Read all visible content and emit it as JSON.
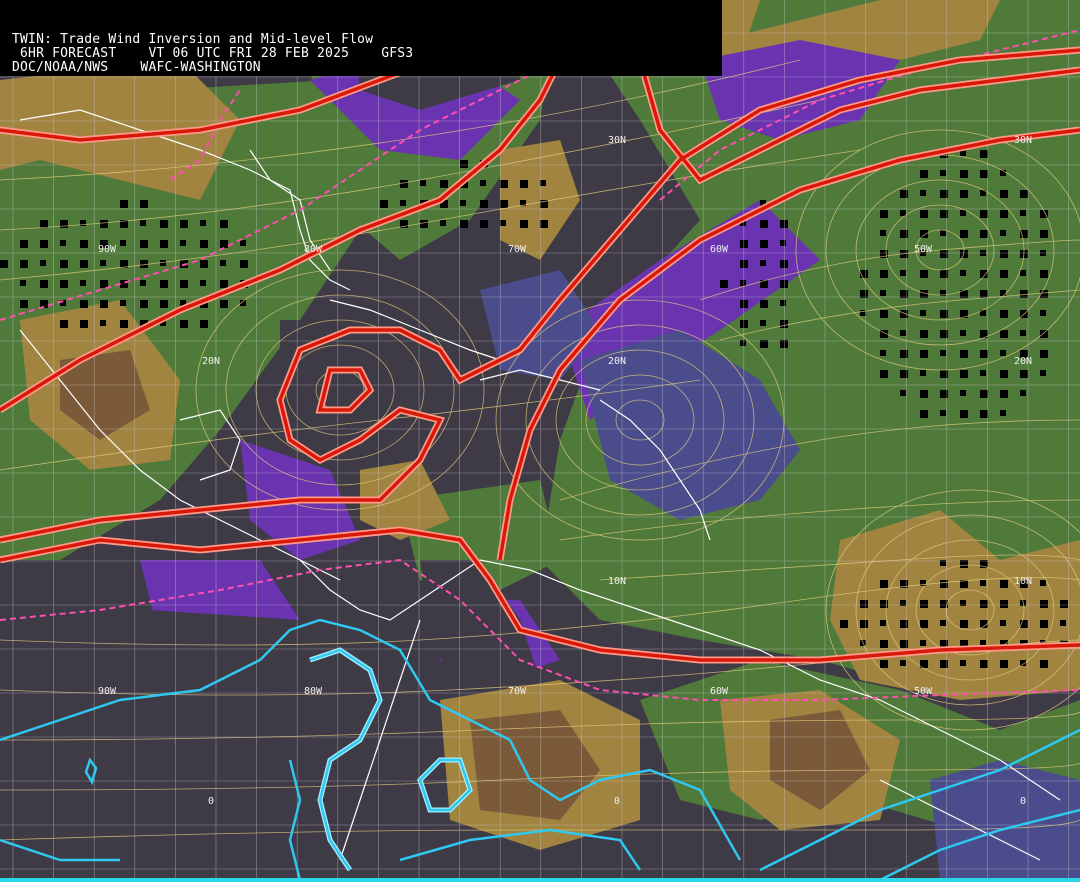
{
  "header": {
    "line1": "TWIN: Trade Wind Inversion and Mid-level Flow",
    "line2": " 6HR FORECAST    VT 06 UTC FRI 28 FEB 2025    GFS3",
    "line3": "DOC/NOAA/NWS    WAFC-WASHINGTON"
  },
  "grid_labels": {
    "lat": [
      "30N",
      "20N",
      "10N",
      "0"
    ],
    "lon": [
      "90W",
      "80W",
      "70W",
      "60W",
      "50W"
    ]
  },
  "colors": {
    "background_low": "#3e3a46",
    "green": "#4f7a3a",
    "tan": "#a08440",
    "brown": "#7a5a38",
    "purple": "#6a33b0",
    "blue_purple": "#4a4c8c",
    "inversion_contour": "#e02010",
    "dashed_contour": "#ff4fb0",
    "blue_contour": "#2fc8f0",
    "streamline": "#e8d080",
    "coastline": "#ffffff",
    "grid": "#c8c8c8"
  }
}
